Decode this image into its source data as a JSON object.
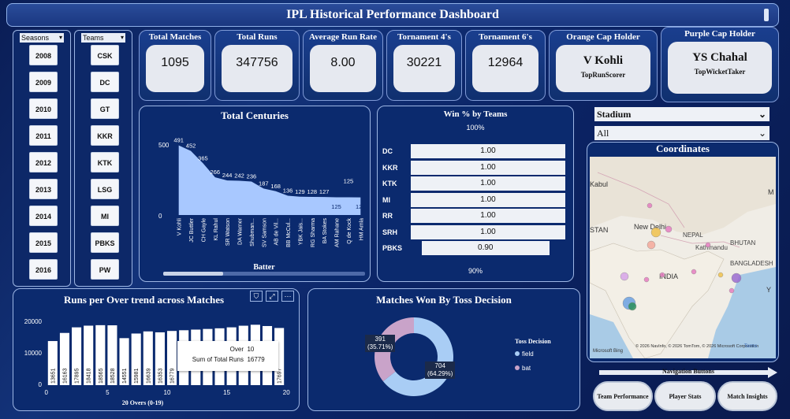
{
  "title": "IPL Historical Performance Dashboard",
  "seasons": {
    "header": "Seasons",
    "items": [
      "2008",
      "2009",
      "2010",
      "2011",
      "2012",
      "2013",
      "2014",
      "2015",
      "2016"
    ]
  },
  "teams": {
    "header": "Teams",
    "items": [
      "CSK",
      "DC",
      "GT",
      "KKR",
      "KTK",
      "LSG",
      "MI",
      "PBKS",
      "PW"
    ]
  },
  "kpis": [
    {
      "label": "Total Matches",
      "value": "1095"
    },
    {
      "label": "Total Runs",
      "value": "347756"
    },
    {
      "label": "Average Run Rate",
      "value": "8.00"
    },
    {
      "label": "Tornament 4's",
      "value": "30221"
    },
    {
      "label": "Tornament 6's",
      "value": "12964"
    }
  ],
  "orange": {
    "label": "Orange Cap Holder",
    "name": "V Kohli",
    "sub": "TopRunScorer"
  },
  "purple": {
    "label": "Purple Cap Holder",
    "name": "YS Chahal",
    "sub": "TopWicketTaker"
  },
  "centuries": {
    "title": "Total Centuries",
    "xlabel": "Batter",
    "yticks": [
      "500",
      "0"
    ],
    "labels": [
      "491",
      "452",
      "365",
      "266",
      "244",
      "242",
      "236",
      "187",
      "168",
      "136",
      "129",
      "128",
      "127",
      "125",
      "125",
      "124"
    ]
  },
  "winpct": {
    "title": "Win % by Teams",
    "top": "100%",
    "bottom": "90%"
  },
  "stadium": {
    "label": "Stadium",
    "value": "All"
  },
  "coords": {
    "title": "Coordinates",
    "places": [
      "Kabul",
      "New Delhi",
      "NEPAL",
      "Kathmandu",
      "BHUTAN",
      "BANGLADESH",
      "INDIA",
      "STAN",
      "Y",
      "M"
    ],
    "copyright": "© 2026 NavInfo, © 2026 TomTom, © 2026 Microsoft Corporation",
    "terms": "Terms",
    "brand": "Microsoft Bing"
  },
  "runs": {
    "title": "Runs per Over trend across Matches",
    "xlabel": "20 Overs (0-19)",
    "yticks": [
      "20000",
      "10000",
      "0"
    ],
    "xticks": [
      "0",
      "5",
      "10",
      "15",
      "20"
    ],
    "tooltip": {
      "k1": "Over",
      "v1": "10",
      "k2": "Sum of Total Runs",
      "v2": "16779"
    }
  },
  "toss": {
    "title": "Matches Won By Toss Decision",
    "legendTitle": "Toss Decision",
    "field": "field",
    "bat": "bat",
    "label_bat": "391",
    "pct_bat": "(35.71%)",
    "label_field": "704",
    "pct_field": "(64.29%)"
  },
  "nav": {
    "title": "Navigation Buttons",
    "buttons": [
      "Team Performance",
      "Player Stats",
      "Match Insights"
    ]
  },
  "colors": {
    "accent": "#a8c8ff",
    "pie_field": "#a9cdf5",
    "pie_bat": "#c9a3c9",
    "map_dot": "#e57cbf"
  },
  "chart_data": [
    {
      "type": "area",
      "title": "Total Centuries",
      "xlabel": "Batter",
      "ylabel": "",
      "ylim": [
        0,
        500
      ],
      "categories": [
        "V Kohli",
        "JC Buttler",
        "CH Gayle",
        "KL Rahul",
        "SR Watson",
        "DA Warner",
        "Shubman...",
        "SV Samson",
        "AB de Vil...",
        "BB McCul...",
        "YBK Jais...",
        "RG Sharma",
        "BA Stokes",
        "AM Rahane",
        "Q de Kock",
        "HM Amla"
      ],
      "values": [
        491,
        452,
        365,
        266,
        244,
        242,
        236,
        187,
        168,
        136,
        129,
        128,
        127,
        125,
        125,
        124
      ]
    },
    {
      "type": "bar",
      "title": "Win % by Teams",
      "categories": [
        "DC",
        "KKR",
        "KTK",
        "MI",
        "RR",
        "SRH",
        "PBKS"
      ],
      "values": [
        1.0,
        1.0,
        1.0,
        1.0,
        1.0,
        1.0,
        0.9
      ],
      "xlim": [
        0.9,
        1.0
      ]
    },
    {
      "type": "bar",
      "title": "Runs per Over trend across Matches",
      "xlabel": "20 Overs (0-19)",
      "ylim": [
        0,
        20000
      ],
      "categories": [
        "0",
        "1",
        "2",
        "3",
        "4",
        "5",
        "6",
        "7",
        "8",
        "9",
        "10",
        "11",
        "12",
        "13",
        "14",
        "15",
        "16",
        "17",
        "18",
        "19"
      ],
      "values": [
        13651,
        16163,
        17895,
        18418,
        18565,
        18528,
        14551,
        15981,
        16639,
        16353,
        16779,
        17000,
        17200,
        17400,
        17600,
        17900,
        18400,
        18700,
        18300,
        17697
      ],
      "value_labels": [
        "13651",
        "16163",
        "17895",
        "18418",
        "18565",
        "18528",
        "14551",
        "15981",
        "16639",
        "16353",
        "16779",
        "",
        "",
        "",
        "",
        "",
        "",
        "",
        "",
        "17697"
      ]
    },
    {
      "type": "pie",
      "title": "Matches Won By Toss Decision",
      "categories": [
        "field",
        "bat"
      ],
      "values": [
        704,
        391
      ],
      "percent": [
        64.29,
        35.71
      ]
    }
  ]
}
